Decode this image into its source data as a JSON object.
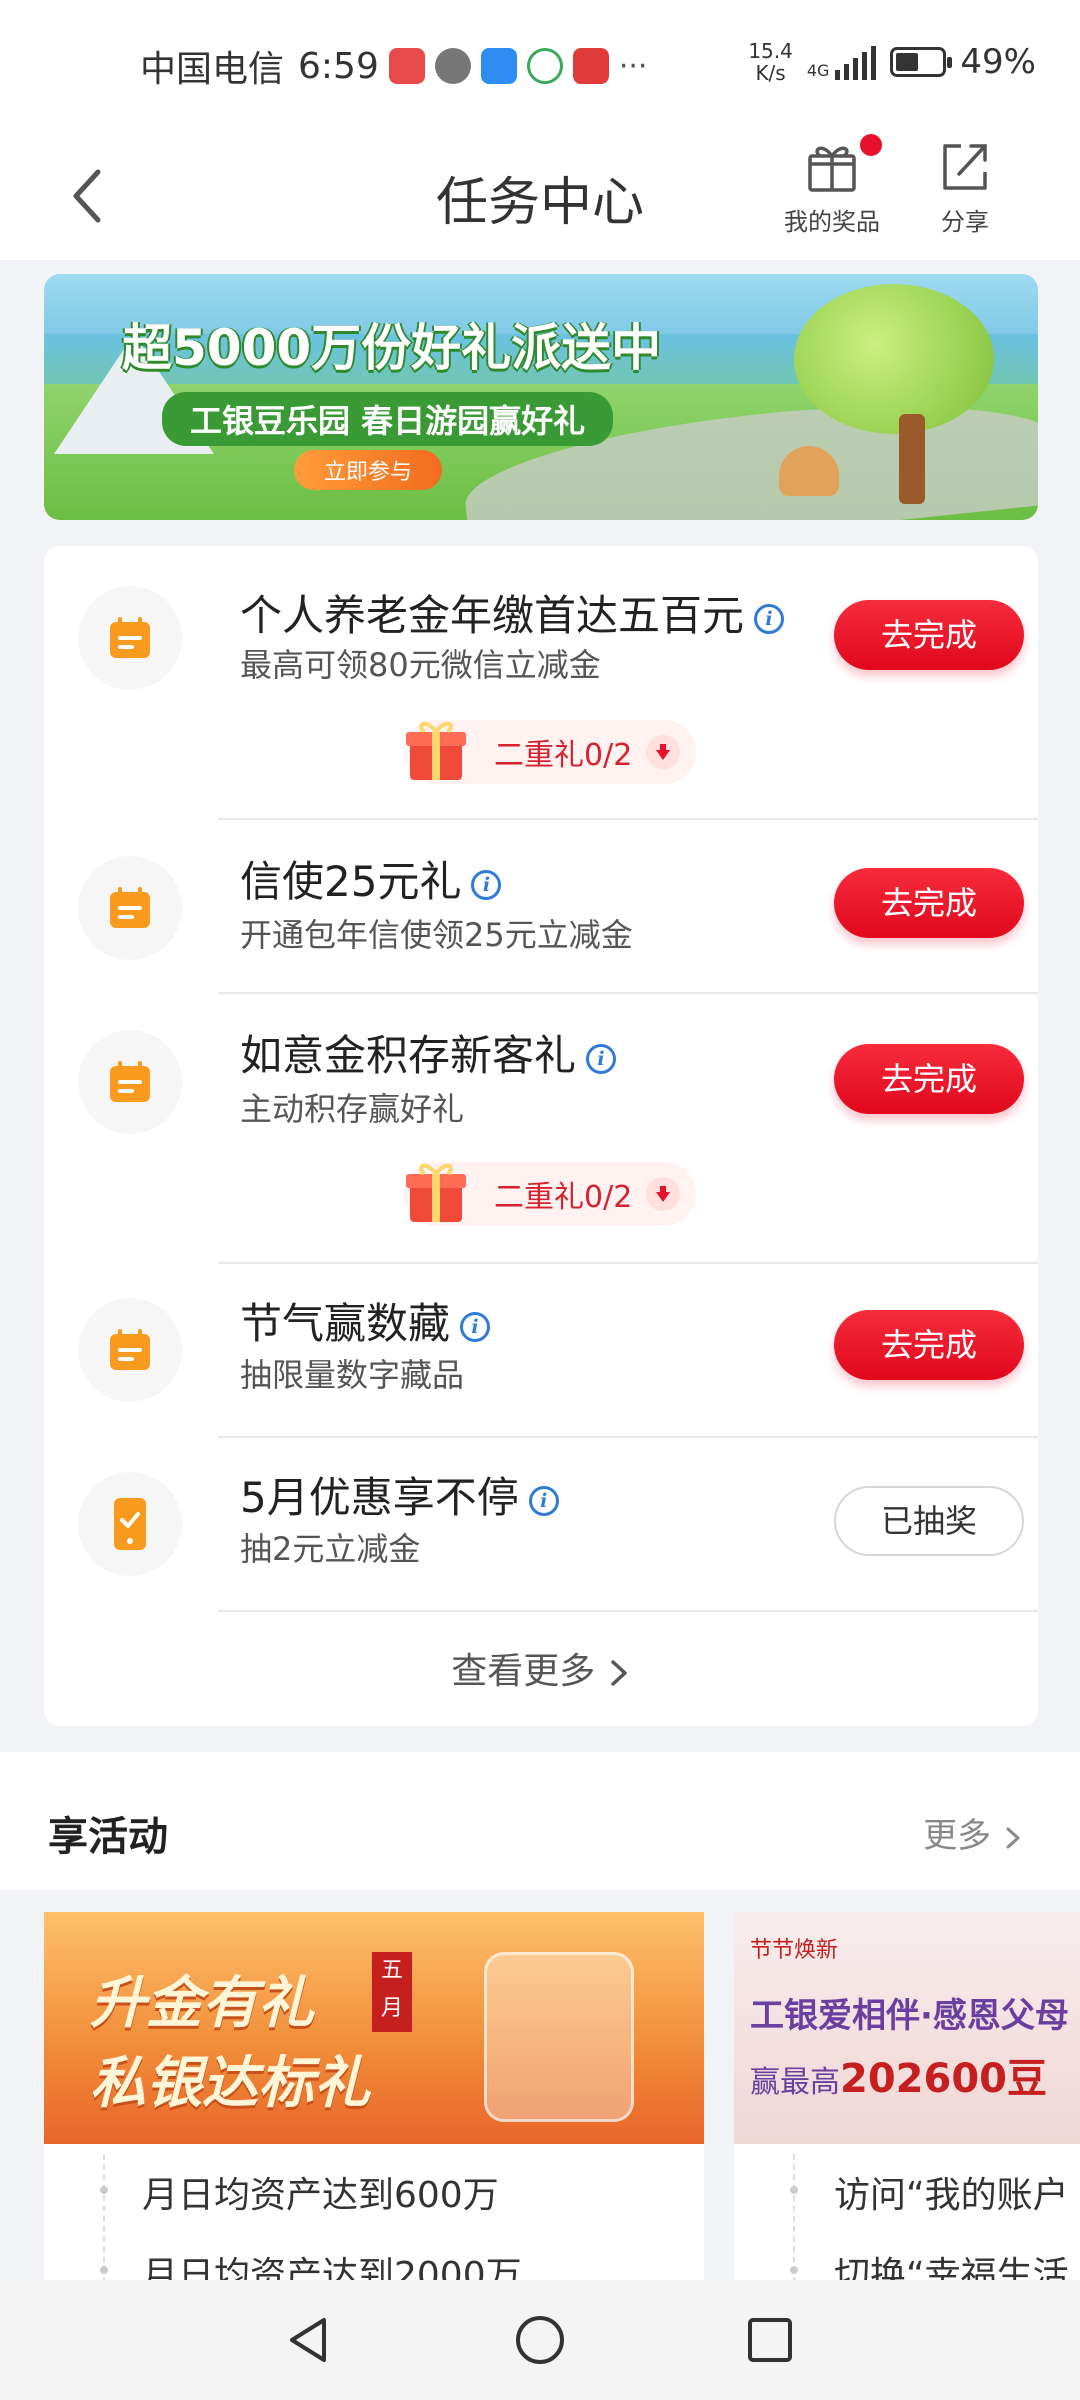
{
  "status_bar": {
    "carrier": "中国电信",
    "time": "6:59",
    "more": "···",
    "net_speed_value": "15.4",
    "net_speed_unit": "K/s",
    "network": "4G",
    "battery_percent": "49%",
    "battery_level": 0.49
  },
  "header": {
    "title": "任务中心",
    "prizes_label": "我的奖品",
    "share_label": "分享"
  },
  "banner": {
    "title": "超5000万份好礼派送中",
    "subtitle": "工银豆乐园 春日游园赢好礼",
    "cta": "立即参与"
  },
  "tasks": [
    {
      "title": "个人养老金年缴首达五百元",
      "subtitle": "最高可领80元微信立减金",
      "button": "去完成",
      "gift": "二重礼0/2"
    },
    {
      "title": "信使25元礼",
      "subtitle": "开通包年信使领25元立减金",
      "button": "去完成"
    },
    {
      "title": "如意金积存新客礼",
      "subtitle": "主动积存赢好礼",
      "button": "去完成",
      "gift": "二重礼0/2"
    },
    {
      "title": "节气赢数藏",
      "subtitle": "抽限量数字藏品",
      "button": "去完成"
    },
    {
      "title": "5月优惠享不停",
      "subtitle": "抽2元立减金",
      "button": "已抽奖"
    }
  ],
  "see_more": "查看更多",
  "activities": {
    "title": "享活动",
    "more": "更多",
    "cards": [
      {
        "image_line1": "升金有礼",
        "image_line2": "私银达标礼",
        "month_badge": "五月",
        "items": [
          "月日均资产达到600万",
          "月日均资产达到2000万"
        ]
      },
      {
        "tag": "节节焕新",
        "image_line1": "工银爱相伴·感恩父母",
        "image_line2_prefix": "赢最高",
        "image_line2_value": "202600豆",
        "items": [
          "访问“我的账户",
          "切换“幸福生活"
        ]
      }
    ]
  },
  "colors": {
    "accent_red": "#e8112d",
    "task_icon_orange": "#f79a1e",
    "info_blue": "#2f7bd8"
  },
  "icons": {
    "back": "chevron-left-icon",
    "prizes": "gift-icon",
    "share": "share-icon",
    "task": "calendar-icon",
    "task_last": "phone-check-icon",
    "info": "info-icon",
    "gift": "gift-box-icon",
    "arrow_down": "arrow-down-icon",
    "more": "chevron-right-icon"
  }
}
